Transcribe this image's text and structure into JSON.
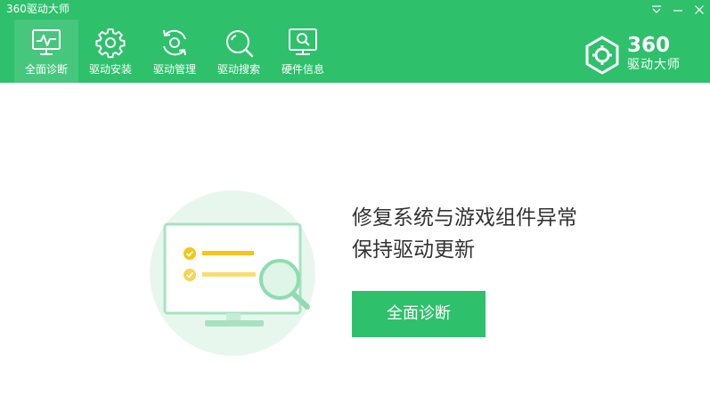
{
  "window": {
    "title": "360驱动大师",
    "controls": [
      {
        "name": "menu",
        "icon": "dropdown-menu-icon"
      },
      {
        "name": "minimize",
        "icon": "minimize-icon"
      },
      {
        "name": "close",
        "icon": "close-icon"
      }
    ]
  },
  "nav": {
    "items": [
      {
        "label": "全面诊断",
        "icon": "monitor-pulse-icon",
        "active": true
      },
      {
        "label": "驱动安装",
        "icon": "gear-icon",
        "active": false
      },
      {
        "label": "驱动管理",
        "icon": "refresh-gear-icon",
        "active": false
      },
      {
        "label": "驱动搜索",
        "icon": "search-icon",
        "active": false
      },
      {
        "label": "硬件信息",
        "icon": "monitor-search-icon",
        "active": false
      }
    ]
  },
  "brand": {
    "logo_text": "360",
    "name": "驱动大师"
  },
  "main": {
    "headline_line1": "修复系统与游戏组件异常",
    "headline_line2": "保持驱动更新",
    "primary_button": "全面诊断"
  },
  "colors": {
    "brand_green": "#2ec06b",
    "text_dark": "#333333",
    "illustration_bg": "#e8f7ee",
    "check_yellow": "#f5c518"
  }
}
